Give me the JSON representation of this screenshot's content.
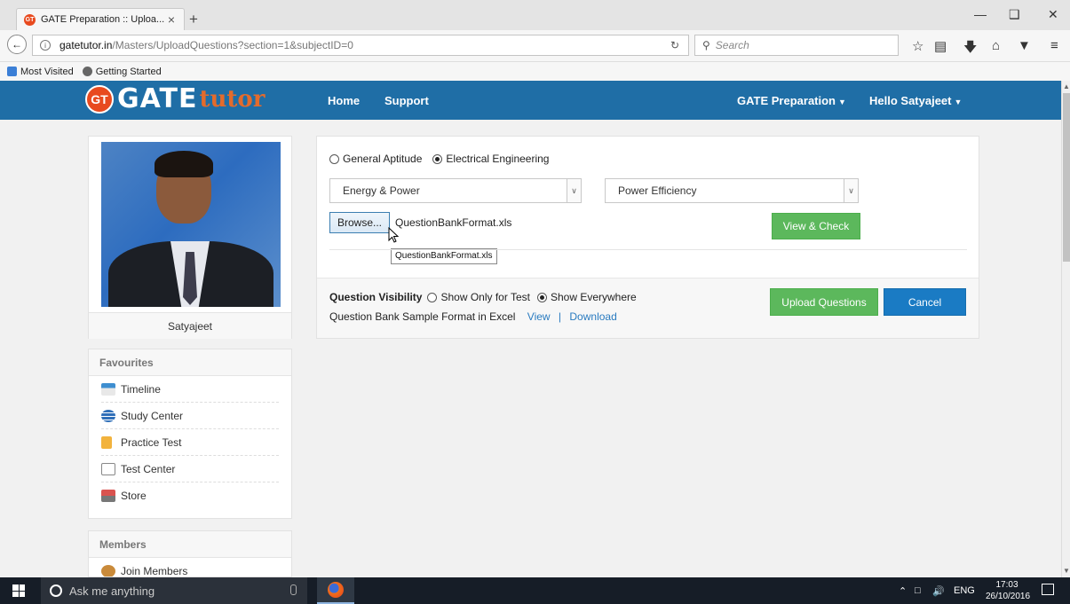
{
  "browser": {
    "tab_title": "GATE Preparation :: Uploa...",
    "tab_close": "×",
    "new_tab": "+",
    "url_host": "gatetutor.in",
    "url_path": "/Masters/UploadQuestions?section=1&subjectID=0",
    "search_placeholder": "Search",
    "bookmarks": [
      "Most Visited",
      "Getting Started"
    ]
  },
  "header": {
    "logo_badge": "GT",
    "logo_gate": "GATE",
    "logo_tutor": "tutor",
    "nav": [
      "Home",
      "Support"
    ],
    "right_menu": [
      "GATE Preparation",
      "Hello Satyajeet"
    ]
  },
  "profile": {
    "name": "Satyajeet"
  },
  "favourites": {
    "title": "Favourites",
    "items": [
      "Timeline",
      "Study Center",
      "Practice Test",
      "Test Center",
      "Store"
    ]
  },
  "members": {
    "title": "Members",
    "items": [
      "Join Members"
    ]
  },
  "upload": {
    "section_options": [
      "General Aptitude",
      "Electrical Engineering"
    ],
    "section_selected": "Electrical Engineering",
    "subject_value": "Energy & Power",
    "topic_value": "Power Efficiency",
    "browse_label": "Browse...",
    "file_name": "QuestionBankFormat.xls",
    "tooltip": "QuestionBankFormat.xls",
    "view_check_label": "View & Check",
    "visibility_label": "Question Visibility",
    "visibility_options": [
      "Show Only for Test",
      "Show Everywhere"
    ],
    "visibility_selected": "Show Everywhere",
    "sample_text": "Question Bank Sample Format in Excel",
    "view_link": "View",
    "separator": "|",
    "download_link": "Download",
    "upload_label": "Upload Questions",
    "cancel_label": "Cancel"
  },
  "taskbar": {
    "search_placeholder": "Ask me anything",
    "language": "ENG",
    "time": "17:03",
    "date": "26/10/2016"
  },
  "colors": {
    "header_bg": "#1f6ea6",
    "logo_orange": "#e36b2c",
    "green_button": "#5cb85c",
    "blue_button": "#1a7bc4",
    "link": "#2a7bc0"
  }
}
